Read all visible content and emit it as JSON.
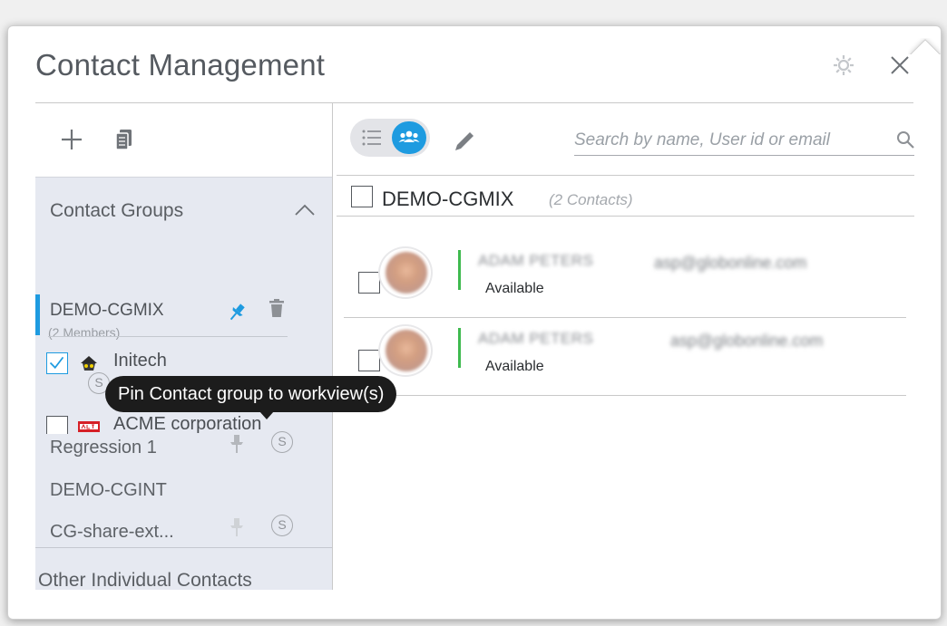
{
  "dialog": {
    "title": "Contact Management"
  },
  "left_toolbar": {
    "add_icon": "plus-icon",
    "copy_icon": "copy-icon"
  },
  "contact_groups": {
    "heading": "Contact Groups",
    "tooltip": "Pin Contact group to workview(s)",
    "selected": {
      "name": "DEMO-CGMIX",
      "members": "(2 Members)",
      "sub_items": [
        {
          "label": "Initech",
          "checked": true,
          "badge": "S"
        },
        {
          "label": "ACME corporation",
          "checked": false
        }
      ]
    },
    "groups": [
      {
        "name": "Regression 1",
        "badge": "S"
      },
      {
        "name": "DEMO-CGINT"
      },
      {
        "name": "CG-share-ext...",
        "badge": "S"
      }
    ],
    "other_contacts": "Other Individual Contacts"
  },
  "right_pane": {
    "search": {
      "placeholder": "Search by name, User id or email",
      "value": ""
    },
    "group_title": "DEMO-CGMIX",
    "group_count": "(2 Contacts)",
    "contacts": [
      {
        "name": "ADAM PETERS",
        "email": "asp@globonline.com",
        "status": "Available"
      },
      {
        "name": "ADAM PETERS",
        "email": "asp@globonline.com",
        "status": "Available"
      }
    ]
  },
  "colors": {
    "accent": "#1e9be0",
    "available": "#3fba4f",
    "panel_bg": "#e6e9f1"
  }
}
